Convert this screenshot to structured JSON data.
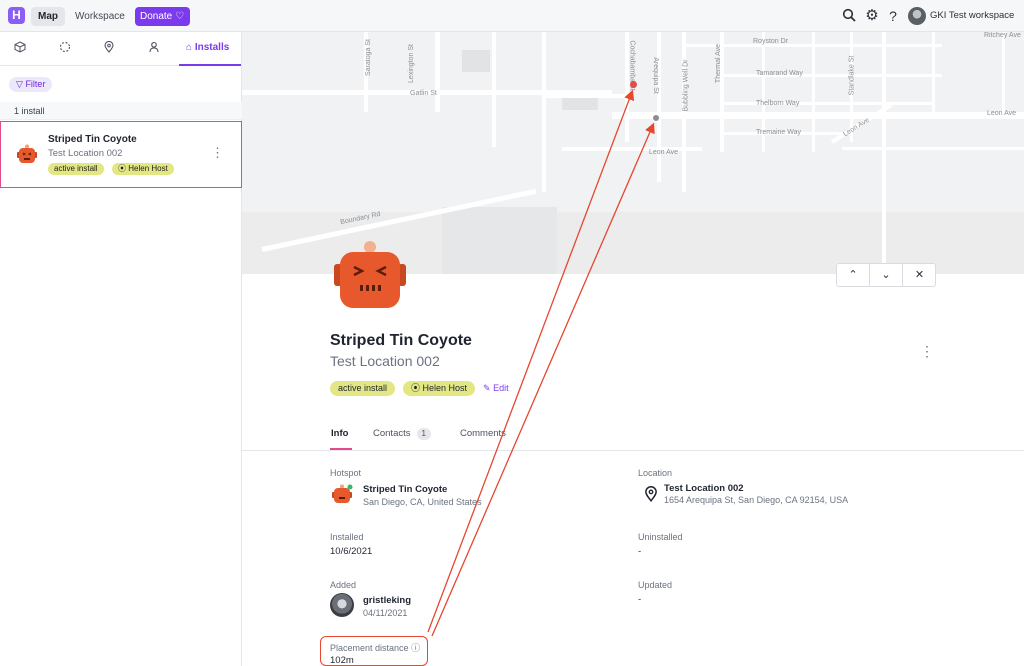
{
  "topbar": {
    "logo_letter": "H",
    "nav_map": "Map",
    "nav_workspace": "Workspace",
    "donate_label": "Donate",
    "workspace_name": "GKI Test workspace"
  },
  "left": {
    "tab_installs": "Installs",
    "filter_label": "Filter",
    "count_label": "1 install",
    "item": {
      "title": "Striped Tin Coyote",
      "subtitle": "Test Location 002",
      "status_pill": "active install",
      "host_pill": "Helen Host"
    }
  },
  "map": {
    "streets": [
      "Saratoga St",
      "Lexington St",
      "Gatlin St",
      "Cochabamba St",
      "Arequipa St",
      "Bubbling Well Dr",
      "Thermal Ave",
      "Royston Dr",
      "Tamarand Way",
      "Thelborn Way",
      "Tremaine Way",
      "Standlake St",
      "Leon Ave",
      "Leon Ave",
      "Leon Ave",
      "Boundary Rd",
      "Ritchey Ave"
    ]
  },
  "detail": {
    "title": "Striped Tin Coyote",
    "subtitle": "Test Location 002",
    "status_pill": "active install",
    "host_pill": "Helen Host",
    "edit_label": "Edit",
    "tabs": {
      "info": "Info",
      "contacts": "Contacts",
      "contacts_count": "1",
      "comments": "Comments"
    },
    "hotspot_label": "Hotspot",
    "hotspot_name": "Striped Tin Coyote",
    "hotspot_place": "San Diego, CA, United States",
    "location_label": "Location",
    "location_name": "Test Location 002",
    "location_address": "1654 Arequipa St, San Diego, CA 92154, USA",
    "installed_label": "Installed",
    "installed_value": "10/6/2021",
    "uninstalled_label": "Uninstalled",
    "uninstalled_value": "-",
    "added_label": "Added",
    "added_user": "gristleking",
    "added_date": "04/11/2021",
    "updated_label": "Updated",
    "updated_value": "-",
    "placement_label": "Placement distance",
    "placement_value": "102m"
  },
  "colors": {
    "accent": "#7c3aed",
    "pill": "#e2e784",
    "highlight": "#e24c8c",
    "annotation": "#e5472f",
    "robot": "#e8582d"
  }
}
